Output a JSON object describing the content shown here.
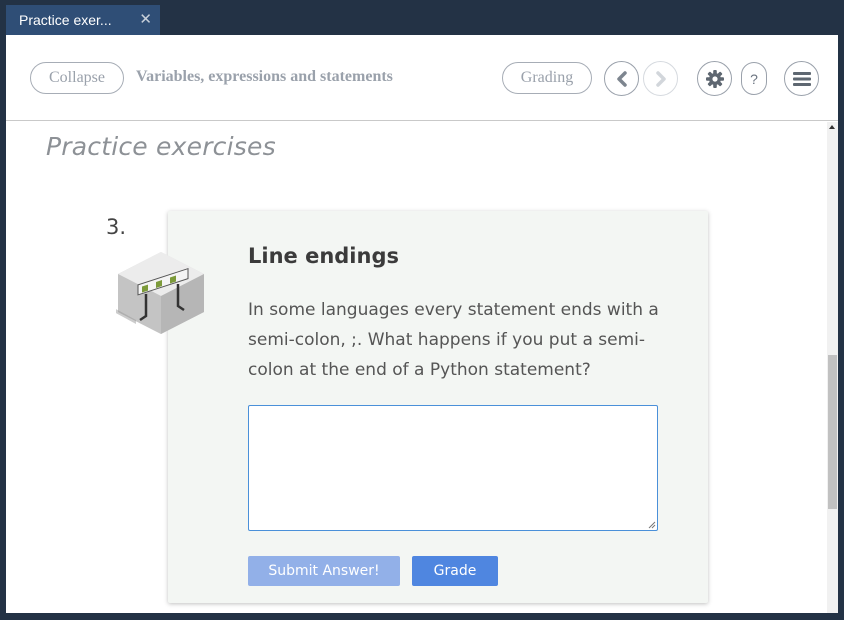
{
  "tab": {
    "title": "Practice exer...",
    "close_icon": "close-icon"
  },
  "toolbar": {
    "collapse_label": "Collapse",
    "chapter_title": "Variables, expressions and statements",
    "grading_label": "Grading",
    "help_label": "?"
  },
  "content": {
    "section_title": "Practice exercises",
    "exercise": {
      "number": "3.",
      "title": "Line endings",
      "question": "In some languages every statement ends with a semi-colon, ;. What happens if you put a semi-colon at the end of a Python statement?",
      "answer_value": "",
      "submit_label": "Submit Answer!",
      "grade_label": "Grade"
    }
  },
  "colors": {
    "tab_active": "#2f4e76",
    "frame": "#233245",
    "accent_blue": "#4f86e0",
    "submit_disabled": "#92b0e8",
    "card_bg": "#f3f6f3"
  }
}
